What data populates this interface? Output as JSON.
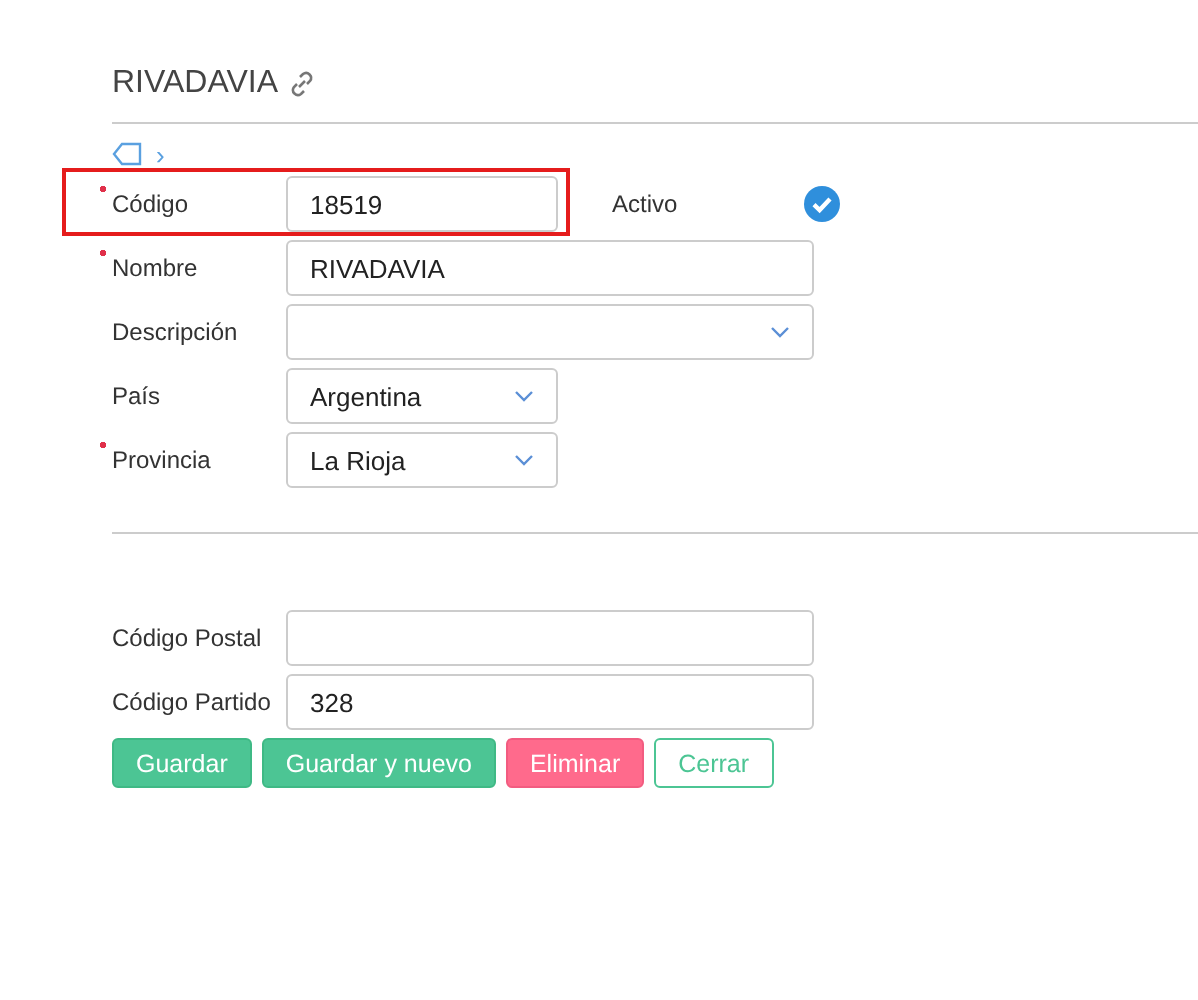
{
  "header": {
    "title": "RIVADAVIA"
  },
  "breadcrumb": {
    "separator": "›"
  },
  "fields": [
    {
      "label": "Código",
      "kind": "input",
      "value": "18519",
      "required": true,
      "highlighted": true
    },
    {
      "label": "Nombre",
      "kind": "input",
      "value": "RIVADAVIA",
      "required": true,
      "highlighted": false
    },
    {
      "label": "Descripción",
      "kind": "select",
      "required": false,
      "highlighted": false
    },
    {
      "label": "País",
      "kind": "select",
      "value": "Argentina",
      "required": false,
      "highlighted": false
    },
    {
      "label": "Provincia",
      "kind": "select",
      "value": "La Rioja",
      "required": true,
      "highlighted": false
    }
  ],
  "active": {
    "label": "Activo",
    "checked": true
  },
  "extra_fields": [
    {
      "label": "Código Postal",
      "kind": "input",
      "required": false,
      "highlighted": false
    },
    {
      "label": "Código Partido",
      "kind": "input",
      "value": "328",
      "required": false,
      "highlighted": false
    }
  ],
  "buttons": [
    {
      "label": "Guardar",
      "kind": "primary"
    },
    {
      "label": "Guardar y nuevo",
      "kind": "primary"
    },
    {
      "label": "Eliminar",
      "kind": "danger"
    },
    {
      "label": "Cerrar",
      "kind": "outline"
    }
  ]
}
